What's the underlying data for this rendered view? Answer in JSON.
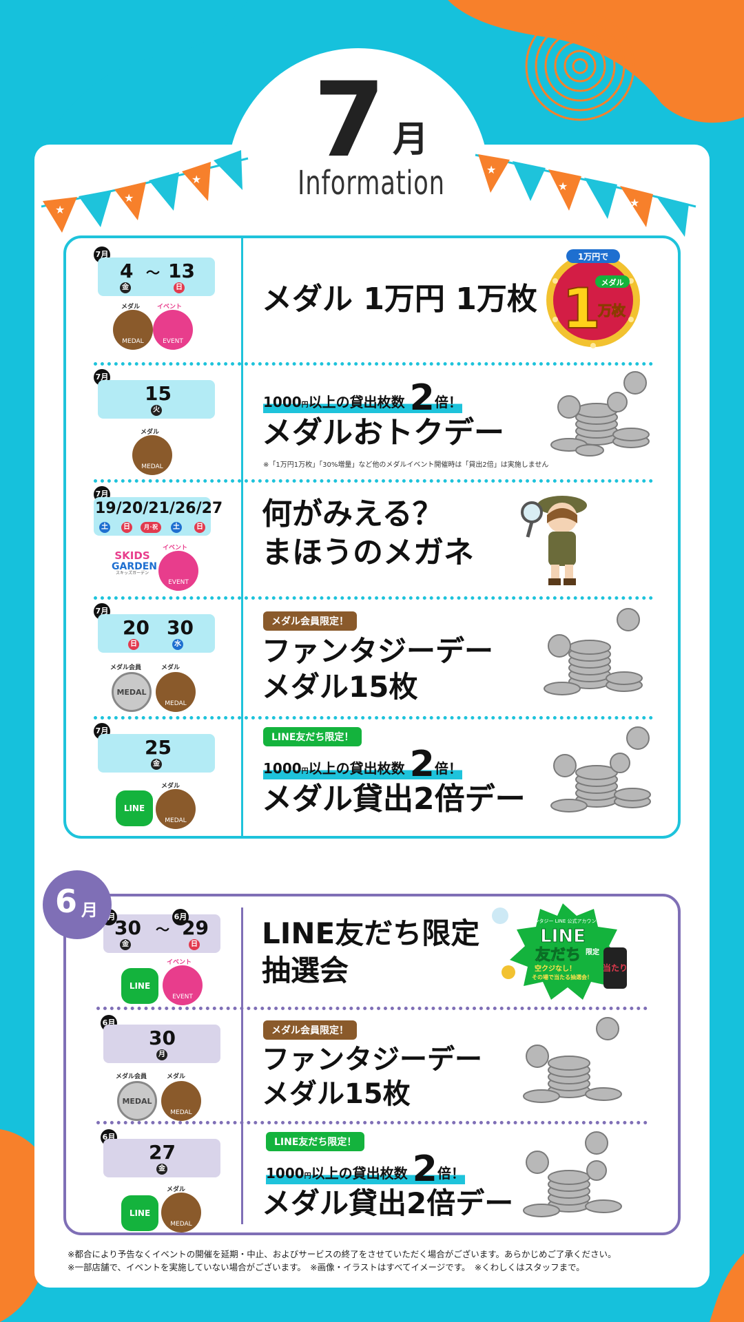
{
  "header": {
    "month_number": "7",
    "month_unit": "月",
    "subtitle": "Information"
  },
  "july": {
    "events": [
      {
        "month_badge": "7月",
        "date_start": "4",
        "dow_start": "金",
        "tilde": "～",
        "date_end": "13",
        "dow_end": "日",
        "icons": [
          "medal",
          "event"
        ],
        "icon_labels": {
          "medal_top": "メダル",
          "medal_bottom": "MEDAL",
          "event_top": "イベント",
          "event_bottom": "EVENT"
        },
        "title": "メダル 1万円 1万枚",
        "art": {
          "top": "1万円で",
          "number": "1",
          "badge": "メダル",
          "suffix": "万枚"
        }
      },
      {
        "month_badge": "7月",
        "date": "15",
        "dow": "火",
        "icons": [
          "medal"
        ],
        "icon_labels": {
          "medal_top": "メダル",
          "medal_bottom": "MEDAL"
        },
        "sub_prefix": "1000",
        "sub_yen": "円",
        "sub_mid": "以上の貸出枚数",
        "sub_big": "2",
        "sub_suffix": "倍！",
        "title": "メダルおトクデー",
        "note": "※「1万円1万枚」「30%増量」など他のメダルイベント開催時は「貸出2倍」は実施しません"
      },
      {
        "month_badge": "7月",
        "dates": [
          {
            "d": "19",
            "w": "土"
          },
          {
            "d": "20",
            "w": "日"
          },
          {
            "d": "21",
            "w": "月･祝"
          },
          {
            "d": "26",
            "w": "土"
          },
          {
            "d": "27",
            "w": "日"
          }
        ],
        "date_text": "19/20/21/26/27",
        "icons": [
          "skids",
          "event"
        ],
        "icon_labels": {
          "skids_1": "SKIDS",
          "skids_2": "GARDEN",
          "skids_3": "スキッズガーデン",
          "event_top": "イベント",
          "event_bottom": "EVENT"
        },
        "title_line1": "何がみえる？",
        "title_line2": "まほうのメガネ"
      },
      {
        "month_badge": "7月",
        "date_start": "20",
        "dow_start": "日",
        "date_end": "30",
        "dow_end": "水",
        "icons": [
          "member",
          "medal"
        ],
        "icon_labels": {
          "member_top": "メダル会員",
          "member_text": "MEDAL",
          "medal_top": "メダル",
          "medal_bottom": "MEDAL"
        },
        "tag": "メダル会員限定！",
        "title_line1": "ファンタジーデー",
        "title_line2": "メダル15枚"
      },
      {
        "month_badge": "7月",
        "date": "25",
        "dow": "金",
        "icons": [
          "line",
          "medal"
        ],
        "icon_labels": {
          "line_text": "LINE",
          "medal_top": "メダル",
          "medal_bottom": "MEDAL"
        },
        "tag": "LINE友だち限定！",
        "sub_prefix": "1000",
        "sub_yen": "円",
        "sub_mid": "以上の貸出枚数",
        "sub_big": "2",
        "sub_suffix": "倍！",
        "title": "メダル貸出2倍デー"
      }
    ]
  },
  "june": {
    "badge_number": "6",
    "badge_unit": "月",
    "events": [
      {
        "month_badge_start": "5月",
        "date_start": "30",
        "dow_start": "金",
        "tilde": "～",
        "month_badge_end": "6月",
        "date_end": "29",
        "dow_end": "日",
        "icons": [
          "line",
          "event"
        ],
        "icon_labels": {
          "line_text": "LINE",
          "event_top": "イベント",
          "event_bottom": "EVENT"
        },
        "title_line1": "LINE友だち限定",
        "title_line2": "抽選会",
        "art": {
          "small": "ファンタジー LINE 公式アカウント",
          "line1": "LINE",
          "line2": "友だち",
          "tag": "限定",
          "sub1": "空クジなし！",
          "sub2": "その場で当たる抽選会！",
          "hit": "当たり"
        }
      },
      {
        "month_badge": "6月",
        "date": "30",
        "dow": "月",
        "icons": [
          "member",
          "medal"
        ],
        "icon_labels": {
          "member_top": "メダル会員",
          "member_text": "MEDAL",
          "medal_top": "メダル",
          "medal_bottom": "MEDAL"
        },
        "tag": "メダル会員限定！",
        "title_line1": "ファンタジーデー",
        "title_line2": "メダル15枚"
      },
      {
        "month_badge": "6月",
        "date": "27",
        "dow": "金",
        "icons": [
          "line",
          "medal"
        ],
        "icon_labels": {
          "line_text": "LINE",
          "medal_top": "メダル",
          "medal_bottom": "MEDAL"
        },
        "tag": "LINE友だち限定！",
        "sub_prefix": "1000",
        "sub_yen": "円",
        "sub_mid": "以上の貸出枚数",
        "sub_big": "2",
        "sub_suffix": "倍！",
        "title": "メダル貸出2倍デー"
      }
    ]
  },
  "footer": {
    "line1": "※都合により予告なくイベントの開催を延期・中止、およびサービスの終了をさせていただく場合がございます。あらかじめご了承ください。",
    "line2": "※一部店舗で、イベントを実施していない場合がございます。　※画像・イラストはすべてイメージです。　※くわしくはスタッフまで。"
  },
  "colors": {
    "cyan": "#1ec3db",
    "orange": "#f7802b",
    "purple": "#7f6fb6",
    "medal_brown": "#8a5a2b",
    "event_pink": "#e83d8c",
    "line_green": "#14b33d"
  }
}
